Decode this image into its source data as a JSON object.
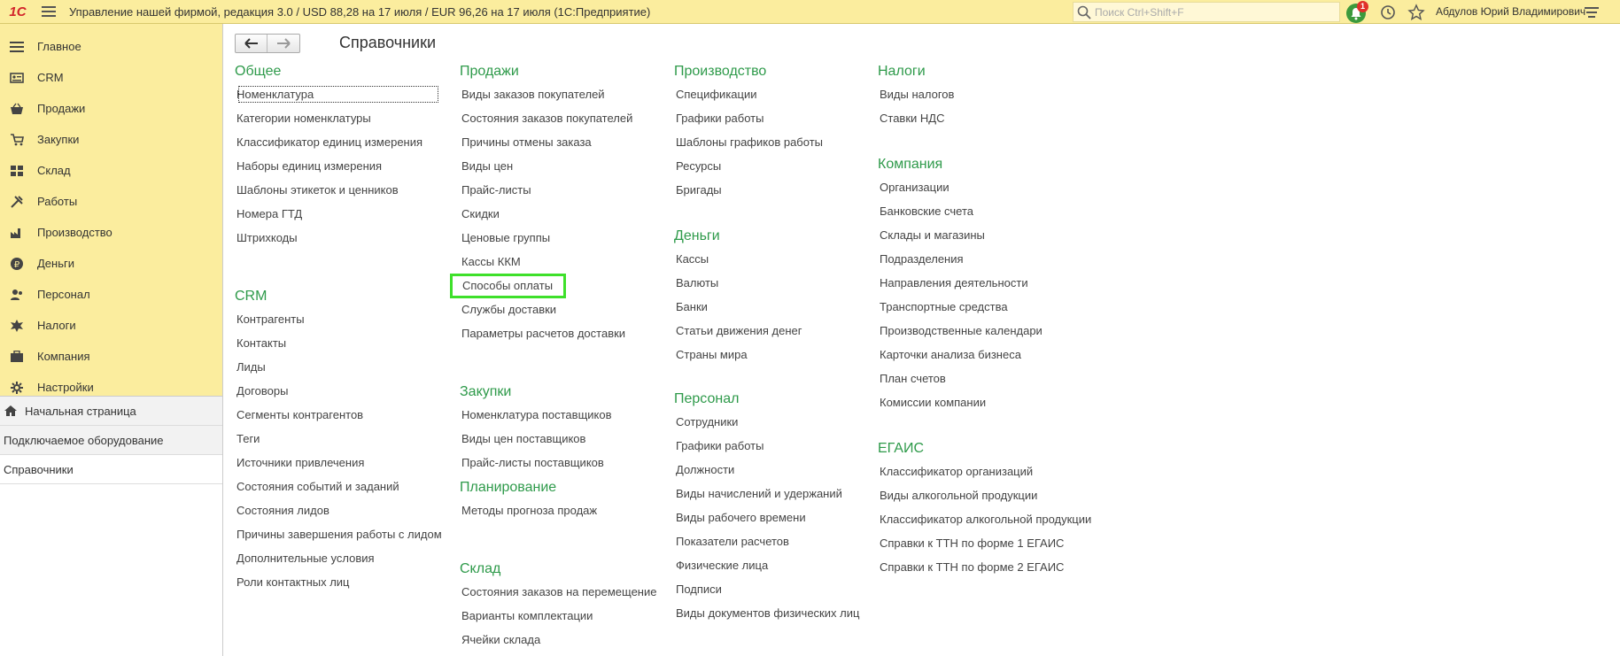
{
  "topbar": {
    "logo": "1С",
    "title": "Управление нашей фирмой, редакция 3.0 / USD 88,28 на 17 июля / EUR 96,26 на 17 июля  (1С:Предприятие)",
    "search_placeholder": "Поиск Ctrl+Shift+F",
    "notifications_count": "1",
    "user": "Абдулов Юрий Владимирович"
  },
  "sidebar": {
    "sections": [
      {
        "label": "Главное",
        "icon": "menu-lines-icon"
      },
      {
        "label": "CRM",
        "icon": "crm-card-icon"
      },
      {
        "label": "Продажи",
        "icon": "basket-icon"
      },
      {
        "label": "Закупки",
        "icon": "cart-icon"
      },
      {
        "label": "Склад",
        "icon": "warehouse-grid-icon"
      },
      {
        "label": "Работы",
        "icon": "tools-icon"
      },
      {
        "label": "Производство",
        "icon": "factory-icon"
      },
      {
        "label": "Деньги",
        "icon": "ruble-coin-icon"
      },
      {
        "label": "Персонал",
        "icon": "people-icon"
      },
      {
        "label": "Налоги",
        "icon": "emblem-icon"
      },
      {
        "label": "Компания",
        "icon": "company-icon"
      },
      {
        "label": "Настройки",
        "icon": "gear-icon"
      }
    ],
    "windows": [
      {
        "label": "Начальная страница"
      },
      {
        "label": "Подключаемое оборудование"
      },
      {
        "label": "Справочники"
      }
    ]
  },
  "main": {
    "title": "Справочники",
    "columns": [
      {
        "groups": [
          {
            "title": "Общее",
            "items": [
              "Номенклатура",
              "Категории номенклатуры",
              "Классификатор единиц измерения",
              "Наборы единиц измерения",
              "Шаблоны этикеток и ценников",
              "Номера ГТД",
              "Штрихкоды"
            ]
          },
          {
            "title": "CRM",
            "items": [
              "Контрагенты",
              "Контакты",
              "Лиды",
              "Договоры",
              "Сегменты контрагентов",
              "Теги",
              "Источники привлечения",
              "Состояния событий и заданий",
              "Состояния лидов",
              "Причины завершения работы с лидом",
              "Дополнительные условия",
              "Роли контактных лиц"
            ]
          }
        ]
      },
      {
        "groups": [
          {
            "title": "Продажи",
            "items": [
              "Виды заказов покупателей",
              "Состояния заказов покупателей",
              "Причины отмены заказа",
              "Виды цен",
              "Прайс-листы",
              "Скидки",
              "Ценовые группы",
              "Кассы ККМ",
              "Способы оплаты",
              "Службы доставки",
              "Параметры расчетов доставки"
            ]
          },
          {
            "title": "Закупки",
            "items": [
              "Номенклатура поставщиков",
              "Виды цен поставщиков",
              "Прайс-листы поставщиков"
            ]
          },
          {
            "title": "Планирование",
            "items": [
              "Методы прогноза продаж"
            ]
          },
          {
            "title": "Склад",
            "items": [
              "Состояния заказов на перемещение",
              "Варианты комплектации",
              "Ячейки склада"
            ]
          }
        ]
      },
      {
        "groups": [
          {
            "title": "Производство",
            "items": [
              "Спецификации",
              "Графики работы",
              "Шаблоны графиков работы",
              "Ресурсы",
              "Бригады"
            ]
          },
          {
            "title": "Деньги",
            "items": [
              "Кассы",
              "Валюты",
              "Банки",
              "Статьи движения денег",
              "Страны мира"
            ]
          },
          {
            "title": "Персонал",
            "items": [
              "Сотрудники",
              "Графики работы",
              "Должности",
              "Виды начислений и удержаний",
              "Виды рабочего времени",
              "Показатели расчетов",
              "Физические лица",
              "Подписи",
              "Виды документов физических лиц"
            ]
          }
        ]
      },
      {
        "groups": [
          {
            "title": "Налоги",
            "items": [
              "Виды налогов",
              "Ставки НДС"
            ]
          },
          {
            "title": "Компания",
            "items": [
              "Организации",
              "Банковские счета",
              "Склады и магазины",
              "Подразделения",
              "Направления деятельности",
              "Транспортные средства",
              "Производственные календари",
              "Карточки анализа бизнеса",
              "План счетов",
              "Комиссии компании"
            ]
          },
          {
            "title": "ЕГАИС",
            "items": [
              "Классификатор организаций",
              "Виды алкогольной продукции",
              "Классификатор алкогольной продукции",
              "Справки к ТТН по форме 1 ЕГАИС",
              "Справки к ТТН по форме 2 ЕГАИС"
            ]
          }
        ]
      }
    ]
  },
  "colors": {
    "accent_green": "#2e9a4a",
    "topbar": "#fbed9e",
    "highlight": "#3ee02a"
  }
}
